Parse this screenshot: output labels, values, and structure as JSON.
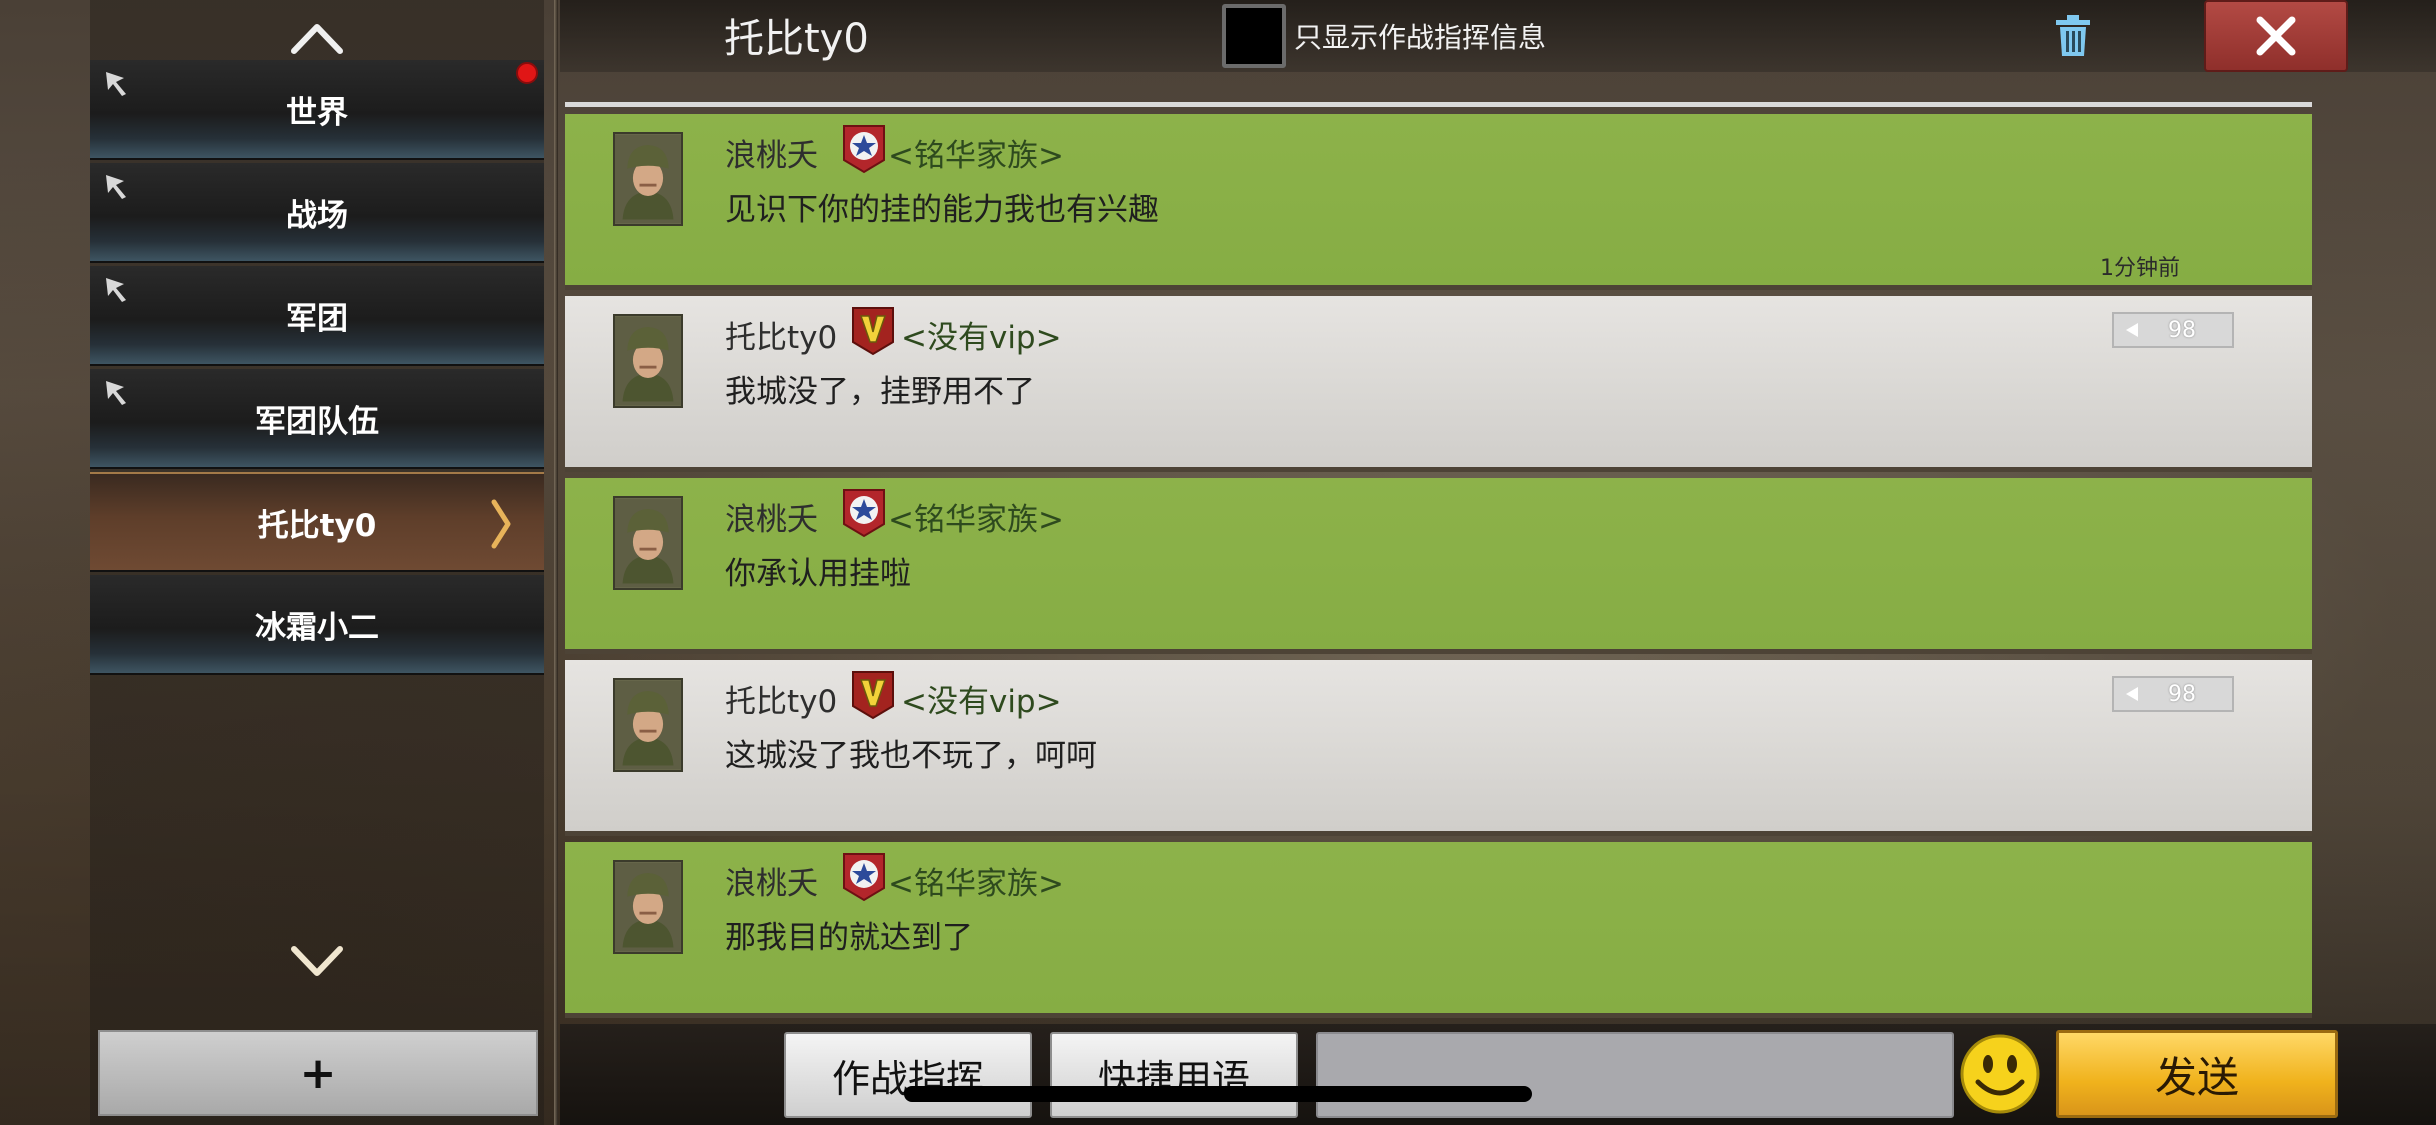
{
  "sidebar": {
    "channels": [
      {
        "label": "世界",
        "pinned": true,
        "notification": true
      },
      {
        "label": "战场",
        "pinned": true
      },
      {
        "label": "军团",
        "pinned": true
      },
      {
        "label": "军团队伍",
        "pinned": true
      },
      {
        "label": "托比ty0",
        "active": true
      },
      {
        "label": "冰霜小二"
      }
    ],
    "add_label": "+"
  },
  "header": {
    "title": "托比ty0",
    "filter_label": "只显示作战指挥信息"
  },
  "messages": [
    {
      "sender": "浪桃夭",
      "tag": "<铭华家族>",
      "text": "见识下你的挂的能力我也有兴趣",
      "time": "1分钟前",
      "style": "green"
    },
    {
      "sender": "托比ty0",
      "tag": "<没有vip>",
      "text": "我城没了，挂野用不了",
      "vip_level": "98",
      "style": "grey"
    },
    {
      "sender": "浪桃夭",
      "tag": "<铭华家族>",
      "text": "你承认用挂啦",
      "style": "green"
    },
    {
      "sender": "托比ty0",
      "tag": "<没有vip>",
      "text": "这城没了我也不玩了，呵呵",
      "vip_level": "98",
      "style": "grey"
    },
    {
      "sender": "浪桃夭",
      "tag": "<铭华家族>",
      "text": "那我目的就达到了",
      "style": "green"
    }
  ],
  "bottom": {
    "command_label": "作战指挥",
    "quick_label": "快捷用语",
    "input_value": "",
    "send_label": "发送"
  },
  "colors": {
    "green_bubble": "#8db24a",
    "grey_bubble": "#dcdad6",
    "send_button": "#f0b21c",
    "close_button": "#a33f3a",
    "notification": "#e01616"
  }
}
